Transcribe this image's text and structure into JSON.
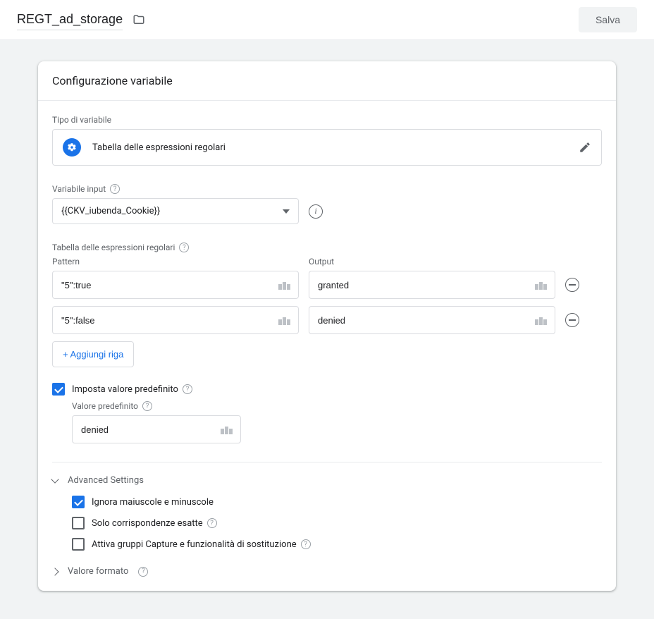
{
  "header": {
    "title": "REGT_ad_storage",
    "save_label": "Salva"
  },
  "panel": {
    "title": "Configurazione variabile"
  },
  "var_type": {
    "label": "Tipo di variabile",
    "name": "Tabella delle espressioni regolari"
  },
  "input_var": {
    "label": "Variabile input",
    "value": "{{CKV_iubenda_Cookie}}"
  },
  "regex_table": {
    "heading": "Tabella delle espressioni regolari",
    "pattern_label": "Pattern",
    "output_label": "Output",
    "rows": [
      {
        "pattern": "\"5\":true",
        "output": "granted"
      },
      {
        "pattern": "\"5\":false",
        "output": "denied"
      }
    ],
    "add_row_label": "+ Aggiungi riga"
  },
  "default_value": {
    "checkbox_label": "Imposta valore predefinito",
    "checked": true,
    "field_label": "Valore predefinito",
    "value": "denied"
  },
  "advanced": {
    "heading": "Advanced Settings",
    "ignore_case": {
      "label": "Ignora maiuscole e minuscole",
      "checked": true
    },
    "exact_match": {
      "label": "Solo corrispondenze esatte",
      "checked": false
    },
    "capture_groups": {
      "label": "Attiva gruppi Capture e funzionalità di sostituzione",
      "checked": false
    }
  },
  "value_format": {
    "heading": "Valore formato"
  }
}
